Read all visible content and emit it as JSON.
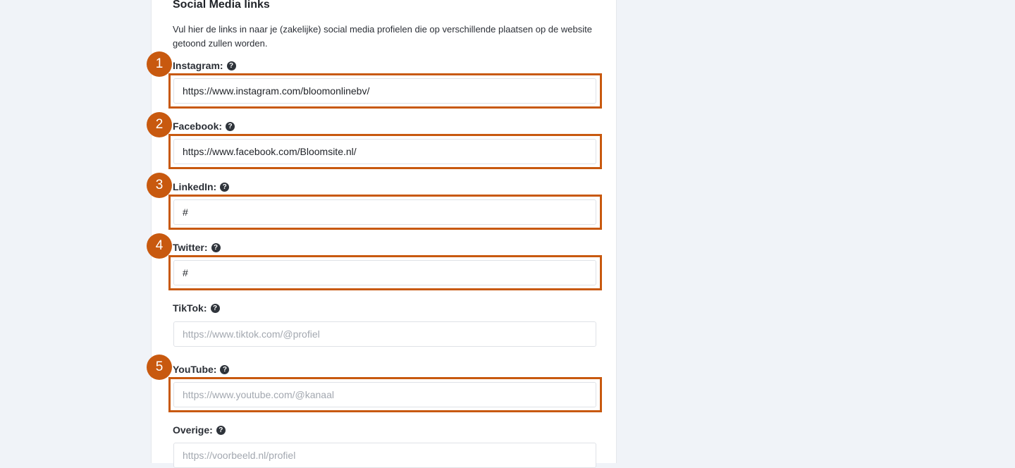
{
  "section": {
    "title": "Social Media links",
    "description": "Vul hier de links in naar je (zakelijke) social media profielen die op verschillende plaatsen op de website getoond zullen worden."
  },
  "help_icon_glyph": "?",
  "fields": {
    "instagram": {
      "label": "Instagram:",
      "value": "https://www.instagram.com/bloomonlinebv/",
      "placeholder": ""
    },
    "facebook": {
      "label": "Facebook:",
      "value": "https://www.facebook.com/Bloomsite.nl/",
      "placeholder": ""
    },
    "linkedin": {
      "label": "LinkedIn:",
      "value": "#",
      "placeholder": ""
    },
    "twitter": {
      "label": "Twitter:",
      "value": "#",
      "placeholder": ""
    },
    "tiktok": {
      "label": "TikTok:",
      "value": "",
      "placeholder": "https://www.tiktok.com/@profiel"
    },
    "youtube": {
      "label": "YouTube:",
      "value": "",
      "placeholder": "https://www.youtube.com/@kanaal"
    },
    "overige": {
      "label": "Overige:",
      "value": "",
      "placeholder": "https://voorbeeld.nl/profiel"
    }
  },
  "annotations": {
    "badge_1": "1",
    "badge_2": "2",
    "badge_3": "3",
    "badge_4": "4",
    "badge_5": "5",
    "highlight_color": "#c8590f"
  },
  "colors": {
    "background": "#f0f3f8",
    "panel": "#ffffff",
    "input_border": "#dfe2e7",
    "text": "#1f2227",
    "placeholder": "#a3a8b0"
  }
}
